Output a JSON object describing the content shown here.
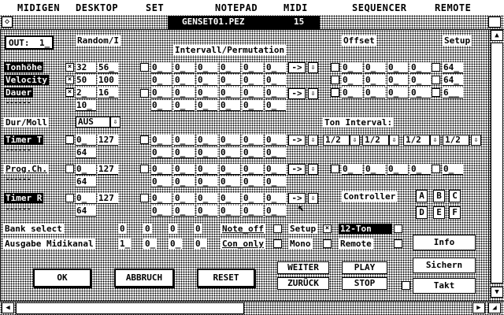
{
  "menubar": {
    "items": [
      "MIDIGEN",
      "DESKTOP",
      "SET",
      "NOTEPAD",
      "MIDI",
      "SEQUENCER",
      "REMOTE"
    ]
  },
  "window": {
    "title": "GENSET01.PEZ",
    "number": "15"
  },
  "out": {
    "label": "OUT:",
    "value": "1_"
  },
  "random_label": "Random/I",
  "intervall_label": "Intervall/Permutation",
  "offset_label": "Offset",
  "setup_label": "Setup",
  "rows": {
    "tonhoehe": {
      "label": "Tonhöhe",
      "v1": "32",
      "v2": "56_"
    },
    "velocity": {
      "label": "Velocity",
      "v1": "50",
      "v2": "100"
    },
    "dauer": {
      "label": "Dauer",
      "v1": "2_",
      "v2": "16_",
      "v3": "10_"
    }
  },
  "setup_values": [
    "64_",
    "64_",
    "6__"
  ],
  "durmoll": {
    "label": "Dur/Moll",
    "value": "AUS"
  },
  "ton_interval_label": "Ton Interval:",
  "ton_interval_values": [
    "1/2",
    "1/2",
    "1/2",
    "1/2"
  ],
  "timer_t": {
    "label": "Timer T",
    "v1": "0_",
    "v2": "127",
    "v3": "64"
  },
  "progch": {
    "label": "Prog.Ch.",
    "v1": "0_",
    "v2": "127",
    "v3": "64"
  },
  "timer_r": {
    "label": "Timer R",
    "v1": "0_",
    "v2": "127",
    "v3": "64"
  },
  "zero": "0_",
  "arrow_right": "->",
  "arrow_down": "⇩",
  "controller": {
    "label": "Controller",
    "buttons": [
      "A",
      "B",
      "C",
      "D",
      "E",
      "F"
    ]
  },
  "bank_select": {
    "label": "Bank select",
    "values": [
      "0",
      "0",
      "0",
      "0"
    ]
  },
  "ausgabe": {
    "label": "Ausgabe Midikanal",
    "values": [
      "1_",
      "0_",
      "0_",
      "0_"
    ]
  },
  "note_off": "Note_off",
  "con_only": "Con_only",
  "setup_chk": "Setup",
  "mono": "Mono",
  "remote": "Remote",
  "twelve_ton": "12-Ton",
  "buttons": {
    "ok": "OK",
    "abbruch": "ABBRUCH",
    "reset": "RESET",
    "weiter": "WEITER",
    "zurueck": "ZURÜCK",
    "play": "PLAY",
    "stop": "STOP",
    "info": "Info",
    "sichern": "Sichern",
    "takt": "Takt"
  },
  "check_mark": "×"
}
